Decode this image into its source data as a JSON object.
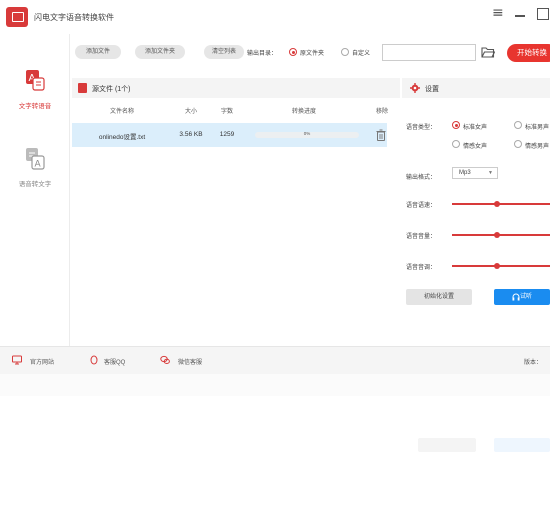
{
  "window": {
    "title": "闪电文字语音转换软件",
    "controls": {
      "menu_glyph": "≡"
    }
  },
  "sidebar": {
    "items": [
      {
        "label": "文字转语音",
        "icon": "text-to-speech-icon",
        "active": true
      },
      {
        "label": "语音转文字",
        "icon": "speech-to-text-icon",
        "active": false
      }
    ]
  },
  "toolbar": {
    "add_file": "添加文件",
    "add_folder": "添加文件夹",
    "clear_list": "清空列表",
    "output_dir_label": "输出目录：",
    "output_options": [
      {
        "label": "原文件夹",
        "checked": true
      },
      {
        "label": "自定义",
        "checked": false
      }
    ],
    "output_path_value": "",
    "start_label": "开始转换"
  },
  "files_panel": {
    "title": "源文件 (1个)",
    "columns": [
      "文件名称",
      "大小",
      "字数",
      "转换进度",
      "移除"
    ],
    "rows": [
      {
        "name": "onlinedo设置.txt",
        "size": "3.56 KB",
        "chars": "1259",
        "progress_pct": 0,
        "progress_text": "0%"
      }
    ]
  },
  "settings": {
    "title": "设置",
    "voice_type_label": "语音类型：",
    "voice_options": [
      {
        "label": "标准女声",
        "checked": true
      },
      {
        "label": "标准男声",
        "checked": false
      },
      {
        "label": "情感女声",
        "checked": false
      },
      {
        "label": "情感男声",
        "checked": false
      }
    ],
    "format_label": "输出格式：",
    "format_value": "Mp3",
    "speed_label": "语音语速：",
    "speed_level": 0.46,
    "volume_label": "语音音量：",
    "volume_level": 0.46,
    "pitch_label": "语音音调：",
    "pitch_level": 0.46,
    "init_button": "初始化设置",
    "listen_button": "试听"
  },
  "footer": {
    "site_label": "官方网站",
    "qq_label": "客服QQ",
    "wechat_label": "微信客服",
    "version_label": "版本："
  },
  "colors": {
    "accent": "#d83a3a",
    "start": "#e8352f",
    "listen": "#1a8cf0",
    "selected_row": "#dbeefb"
  }
}
